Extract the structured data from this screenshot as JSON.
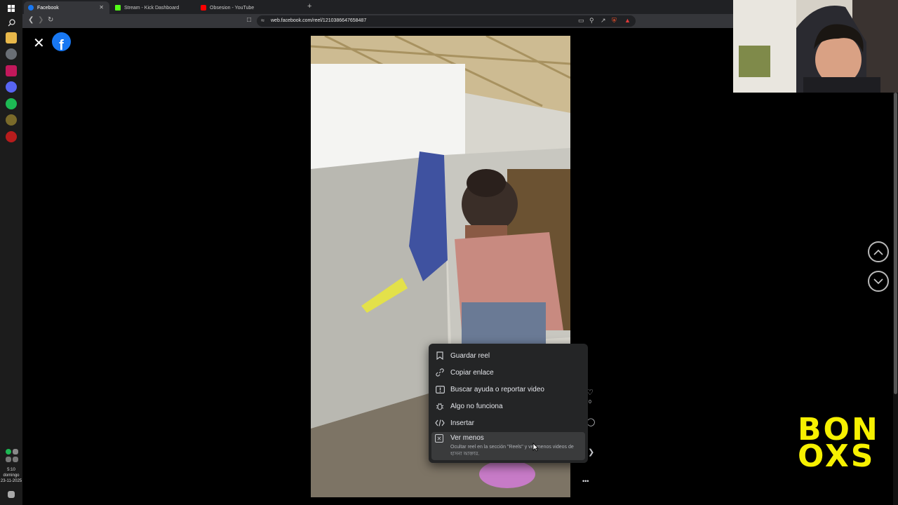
{
  "taskbar": {
    "clock_time": "5:10",
    "clock_day": "domingo",
    "clock_date": "23-11-2025"
  },
  "browser": {
    "tabs": [
      {
        "label": "Facebook",
        "active": true,
        "favicon_color": "#1877f2"
      },
      {
        "label": "Stream - Kick Dashboard",
        "active": false,
        "favicon_color": "#53fc18"
      },
      {
        "label": "Obsesion - YouTube",
        "active": false,
        "favicon_color": "#ff0000"
      }
    ],
    "new_tab_symbol": "+",
    "url": "web.facebook.com/reel/1210386647658487"
  },
  "page": {
    "close_symbol": "✕",
    "logo_letter": "f"
  },
  "menu": {
    "items": [
      {
        "label": "Guardar reel",
        "icon": "bookmark-icon",
        "glyph": "⌑"
      },
      {
        "label": "Copiar enlace",
        "icon": "link-icon",
        "glyph": "⛓"
      },
      {
        "label": "Buscar ayuda o reportar video",
        "icon": "report-icon",
        "glyph": "!"
      },
      {
        "label": "Algo no funciona",
        "icon": "bug-icon",
        "glyph": "✲"
      },
      {
        "label": "Insertar",
        "icon": "embed-icon",
        "glyph": "</>"
      }
    ],
    "hide": {
      "label": "Ver menos",
      "description": "Ocultar reel en la sección \"Reels\" y ver menos videos de হাসনা আক্তার.",
      "icon": "close-box-icon",
      "glyph": "✕"
    }
  },
  "reel_controls": {
    "more_symbol": "•••",
    "count_partial": "0"
  },
  "nav": {
    "up_symbol": "⌃",
    "down_symbol": "⌄"
  },
  "brand": {
    "line1": "BON",
    "line2": "OXS",
    "color": "#f6f000"
  }
}
